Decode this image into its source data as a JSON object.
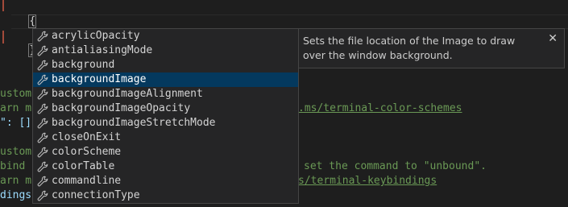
{
  "editor": {
    "line1": "{",
    "line2_ws": "····",
    "line2_quote": "\"",
    "line3": "}",
    "fragments": {
      "f_custom1": "ustom",
      "f_learn1": "arn m",
      "f_prop1": "\": []",
      "f_link1": ".ms/terminal-color-schemes",
      "f_custom2": "ustom",
      "f_bind": "bind",
      "f_unbound": "set the command to \"unbound\".",
      "f_learn2": "arn m",
      "f_link2": "s/terminal-keybindings",
      "f_dings": "dings\""
    }
  },
  "suggest": {
    "items": [
      "acrylicOpacity",
      "antialiasingMode",
      "background",
      "backgroundImage",
      "backgroundImageAlignment",
      "backgroundImageOpacity",
      "backgroundImageStretchMode",
      "closeOnExit",
      "colorScheme",
      "colorTable",
      "commandline",
      "connectionType"
    ],
    "selected_index": 3,
    "item_icon": "wrench-icon"
  },
  "details": {
    "text": "Sets the file location of the Image to draw over the window background.",
    "close_icon": "close-icon"
  },
  "colors": {
    "selection": "#04395e",
    "widget_bg": "#252526",
    "editor_bg": "#1e1e1e",
    "comment": "#6a9955",
    "string": "#ce9178"
  }
}
